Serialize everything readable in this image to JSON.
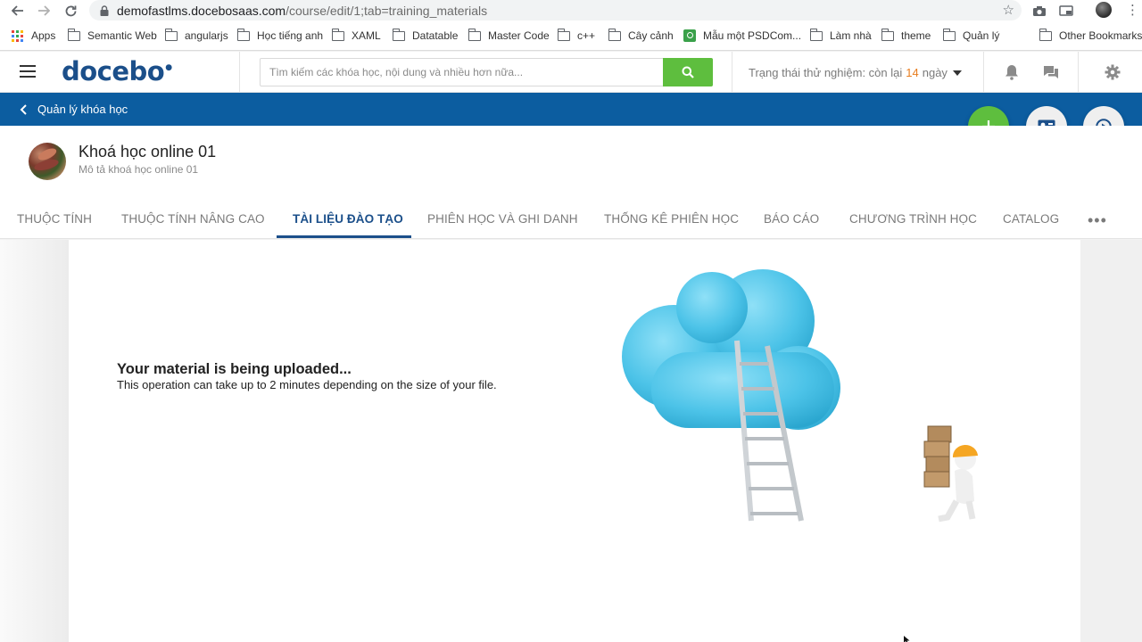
{
  "browser": {
    "url_host": "demofastlms.docebosaas.com",
    "url_path": "/course/edit/1;tab=training_materials",
    "bookmarks": [
      {
        "label": "Apps",
        "type": "apps"
      },
      {
        "label": "Semantic Web",
        "type": "folder"
      },
      {
        "label": "angularjs",
        "type": "folder"
      },
      {
        "label": "Học tiếng anh",
        "type": "folder"
      },
      {
        "label": "XAML",
        "type": "folder"
      },
      {
        "label": "Datatable",
        "type": "folder"
      },
      {
        "label": "Master Code",
        "type": "folder"
      },
      {
        "label": "c++",
        "type": "folder"
      },
      {
        "label": "Cây cảnh",
        "type": "folder"
      },
      {
        "label": "Mẫu một PSDCom...",
        "type": "page"
      },
      {
        "label": "Làm nhà",
        "type": "folder"
      },
      {
        "label": "theme",
        "type": "folder"
      },
      {
        "label": "Quản lý",
        "type": "folder"
      },
      {
        "label": "Other Bookmarks",
        "type": "folder"
      }
    ]
  },
  "header": {
    "logo": "docebo",
    "search_placeholder": "Tìm kiếm các khóa học, nội dung và nhiều hơn nữa...",
    "trial_prefix": "Trạng thái thử nghiệm: còn lại",
    "trial_days": "14",
    "trial_suffix": "ngày"
  },
  "nav": {
    "back_label": "Quản lý khóa học"
  },
  "course": {
    "title": "Khoá học online 01",
    "description": "Mô tả khoá học online 01"
  },
  "tabs": [
    {
      "label": "THUỘC TÍNH",
      "active": false
    },
    {
      "label": "THUỘC TÍNH NÂNG CAO",
      "active": false
    },
    {
      "label": "TÀI LIỆU ĐÀO TẠO",
      "active": true
    },
    {
      "label": "PHIÊN HỌC VÀ GHI DANH",
      "active": false
    },
    {
      "label": "THỐNG KÊ PHIÊN HỌC",
      "active": false
    },
    {
      "label": "BÁO CÁO",
      "active": false
    },
    {
      "label": "CHƯƠNG TRÌNH HỌC",
      "active": false
    },
    {
      "label": "CATALOG",
      "active": false
    }
  ],
  "tabs_more": "•••",
  "upload": {
    "title": "Your material is being uploaded...",
    "subtitle": "This operation can take up to 2 minutes depending on the size of your file."
  },
  "colors": {
    "brand_blue": "#0c5da0",
    "accent_green": "#5ebe3e",
    "trial_orange": "#e87d1e",
    "cloud": "#4cc3e8"
  }
}
